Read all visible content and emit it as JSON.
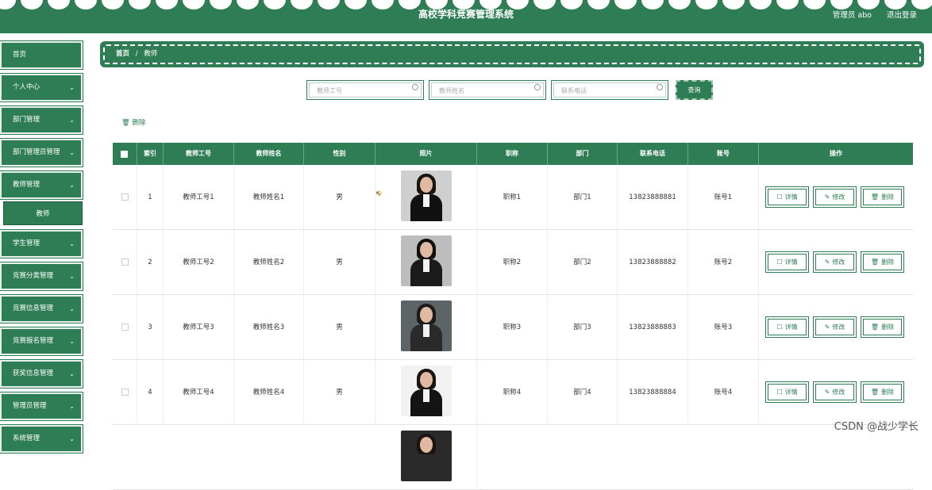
{
  "header": {
    "title": "高校学科竞赛管理系统",
    "user": "管理员 abo",
    "logout": "退出登录"
  },
  "sidebar": {
    "items": [
      {
        "label": "首页",
        "chevron": ""
      },
      {
        "label": "个人中心",
        "chevron": "⌄"
      },
      {
        "label": "部门管理",
        "chevron": "⌄"
      },
      {
        "label": "部门管理员管理",
        "chevron": "⌄"
      },
      {
        "label": "教师管理",
        "chevron": "⌄"
      },
      {
        "label": "学生管理",
        "chevron": "⌄"
      },
      {
        "label": "竞赛分类管理",
        "chevron": "⌄"
      },
      {
        "label": "竞赛信息管理",
        "chevron": "⌄"
      },
      {
        "label": "竞赛报名管理",
        "chevron": "⌄"
      },
      {
        "label": "获奖信息管理",
        "chevron": "⌄"
      },
      {
        "label": "管理员管理",
        "chevron": "⌄"
      },
      {
        "label": "系统管理",
        "chevron": "⌄"
      }
    ],
    "sub_item": "教师"
  },
  "breadcrumb": {
    "home": "首页",
    "sep": "/",
    "current": "教师"
  },
  "search": {
    "teacher_no_placeholder": "教师工号",
    "teacher_name_placeholder": "教师姓名",
    "phone_placeholder": "联系电话",
    "query_label": "查询"
  },
  "bulk_delete": "🗑 删除",
  "table": {
    "headers": [
      "索引",
      "教师工号",
      "教师姓名",
      "性别",
      "照片",
      "职称",
      "部门",
      "联系电话",
      "账号",
      "操作"
    ],
    "rows": [
      {
        "index": "1",
        "no": "教师工号1",
        "name": "教师姓名1",
        "gender": "男",
        "title": "职称1",
        "dept": "部门1",
        "phone": "13823888881",
        "account": "账号1"
      },
      {
        "index": "2",
        "no": "教师工号2",
        "name": "教师姓名2",
        "gender": "男",
        "title": "职称2",
        "dept": "部门2",
        "phone": "13823888882",
        "account": "账号2"
      },
      {
        "index": "3",
        "no": "教师工号3",
        "name": "教师姓名3",
        "gender": "男",
        "title": "职称3",
        "dept": "部门3",
        "phone": "13823888883",
        "account": "账号3"
      },
      {
        "index": "4",
        "no": "教师工号4",
        "name": "教师姓名4",
        "gender": "男",
        "title": "职称4",
        "dept": "部门4",
        "phone": "13823888884",
        "account": "账号4"
      }
    ],
    "actions": {
      "detail": "详情",
      "edit": "修改",
      "delete": "删除"
    }
  },
  "watermark": "CSDN @战少学长",
  "colors": {
    "primary": "#2e7d55",
    "white": "#ffffff"
  }
}
